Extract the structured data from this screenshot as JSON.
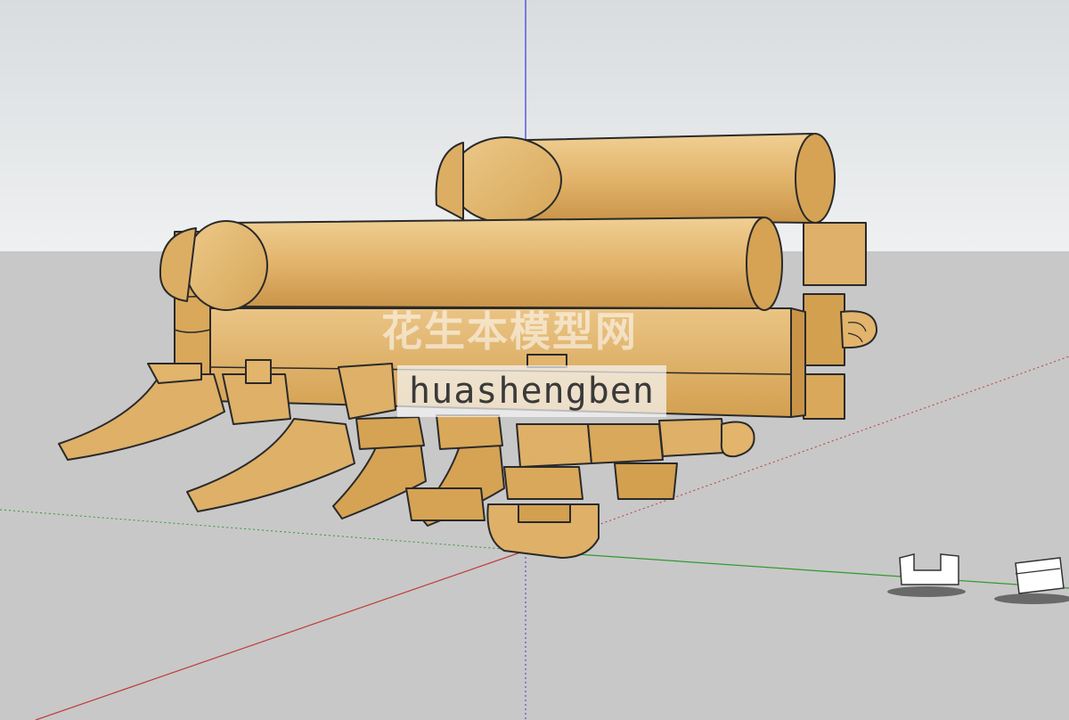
{
  "viewport": {
    "sky_color": "#e6e8ea",
    "ground_color": "#c7c7c7",
    "axis_colors": {
      "red": "#c03a3a",
      "green": "#2f9a2f",
      "blue": "#3a3ad0"
    }
  },
  "model": {
    "name": "bracket-set-dougong",
    "wood_light": "#e8bf7c",
    "wood_mid": "#d9a85a",
    "wood_dark": "#b98436",
    "outline": "#2a2a2a"
  },
  "watermark": {
    "cn_text": "花生本模型网",
    "en_text": "huashengben"
  },
  "components": {
    "icons": [
      "component-instance-icon",
      "component-instance-icon"
    ]
  }
}
